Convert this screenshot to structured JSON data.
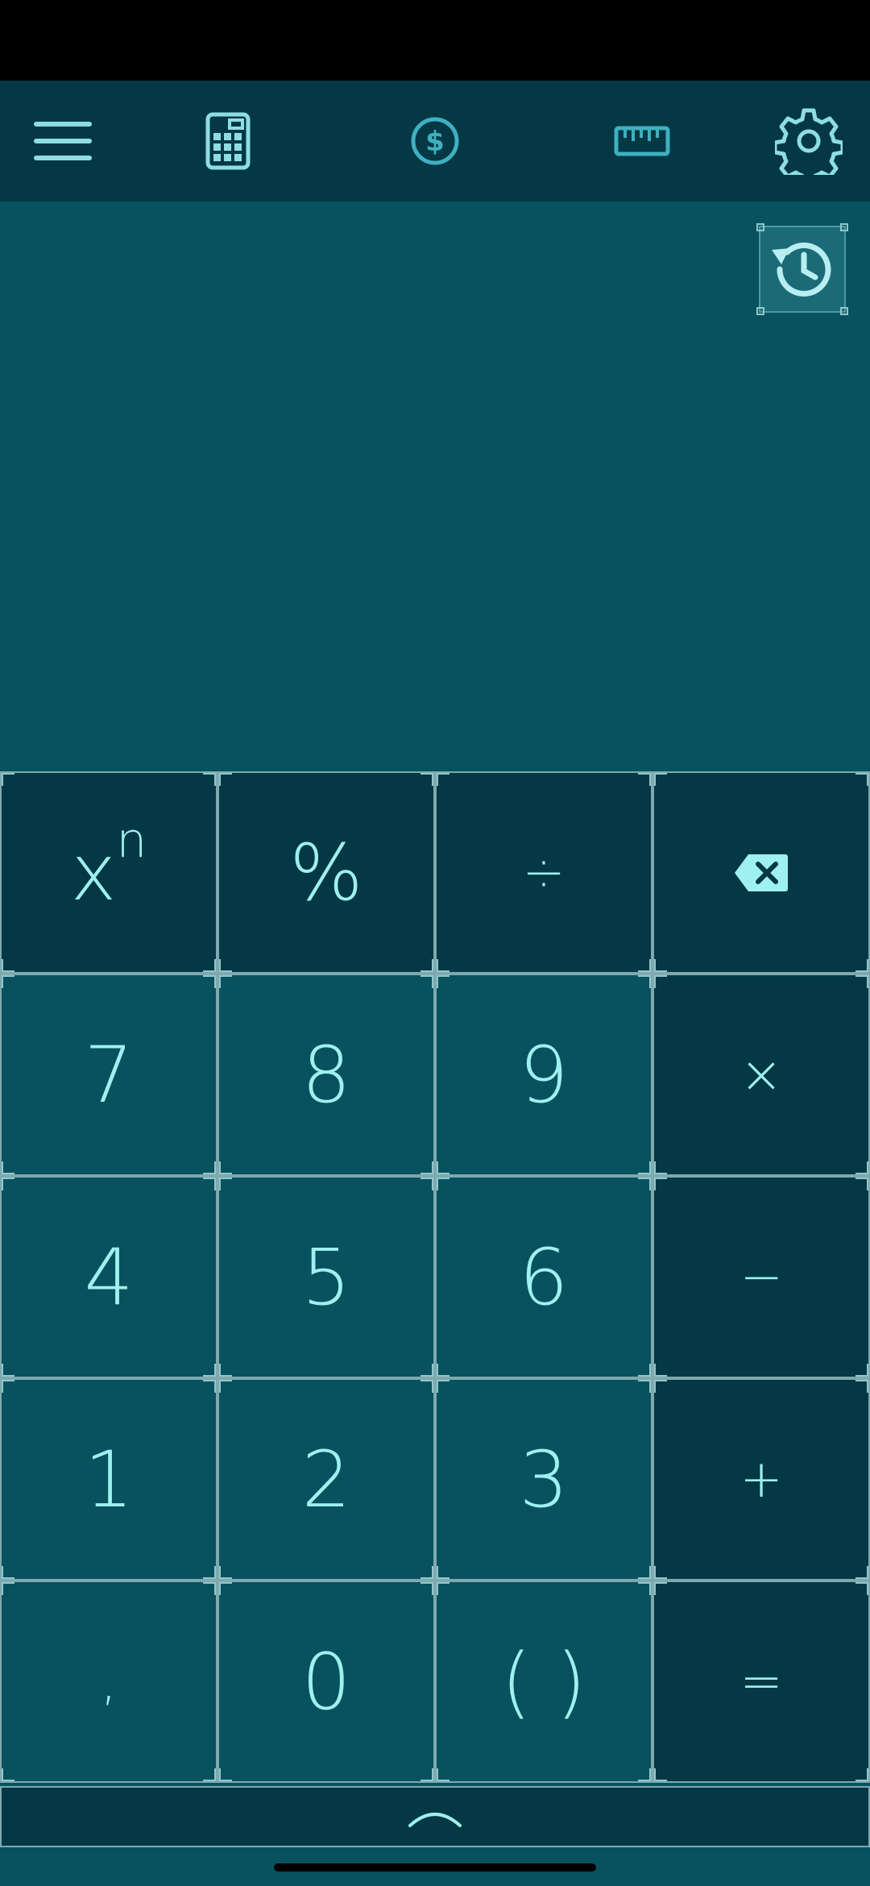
{
  "toolbar": {
    "items": [
      {
        "name": "menu",
        "icon": "hamburger-menu-icon"
      },
      {
        "name": "calculator",
        "icon": "calculator-icon"
      },
      {
        "name": "currency",
        "icon": "dollar-circle-icon"
      },
      {
        "name": "units",
        "icon": "ruler-icon"
      },
      {
        "name": "settings",
        "icon": "gear-icon"
      }
    ]
  },
  "display": {
    "expression": "",
    "history_icon": "history-icon"
  },
  "keypad": {
    "row1": {
      "power_base": "x",
      "power_exp": "n",
      "percent": "%",
      "divide": "÷",
      "backspace_icon": "backspace-icon"
    },
    "row2": {
      "seven": "7",
      "eight": "8",
      "nine": "9",
      "multiply": "×"
    },
    "row3": {
      "four": "4",
      "five": "5",
      "six": "6",
      "minus": "−"
    },
    "row4": {
      "one": "1",
      "two": "2",
      "three": "3",
      "plus": "+"
    },
    "row5": {
      "comma": ",",
      "zero": "0",
      "parens": "( )",
      "equals": "="
    }
  },
  "expand_icon": "chevron-up-icon",
  "colors": {
    "accent": "#9ff0f0",
    "toolbar_bg": "#043845",
    "display_bg": "#07525e",
    "number_key_bg": "#07525e",
    "operator_key_bg": "#043845",
    "border": "#7fa9ae"
  }
}
